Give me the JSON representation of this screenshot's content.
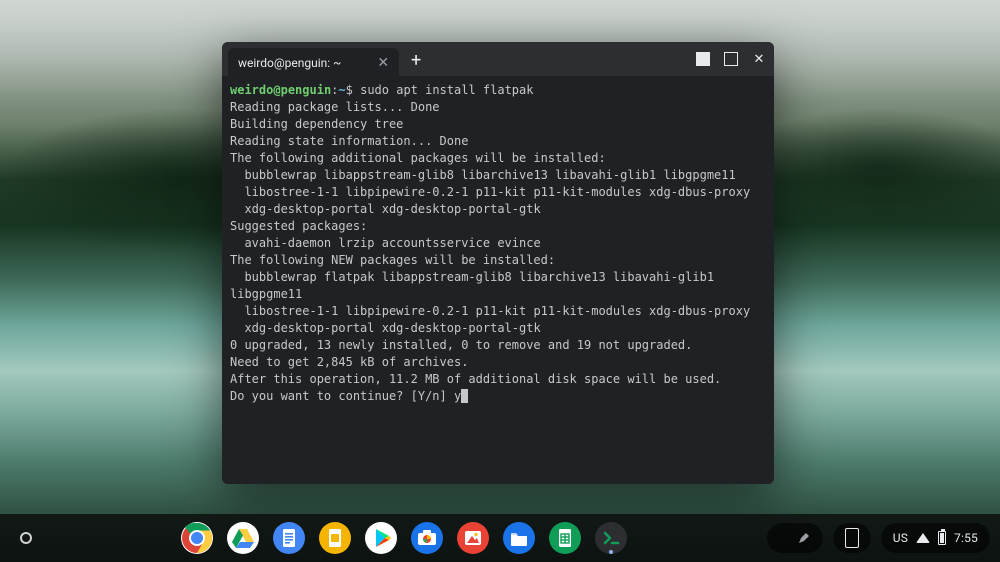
{
  "window": {
    "tab_title": "weirdo@penguin: ~",
    "tab_close": "✕",
    "new_tab": "+",
    "ctrl_close": "✕"
  },
  "prompt": {
    "user": "weirdo",
    "at": "@",
    "host": "penguin",
    "colon": ":",
    "path": "~",
    "dollar": "$ ",
    "command": "sudo apt install flatpak"
  },
  "out": {
    "l01": "Reading package lists... Done",
    "l02": "Building dependency tree",
    "l03": "Reading state information... Done",
    "l04": "The following additional packages will be installed:",
    "l05": "  bubblewrap libappstream-glib8 libarchive13 libavahi-glib1 libgpgme11",
    "l06": "  libostree-1-1 libpipewire-0.2-1 p11-kit p11-kit-modules xdg-dbus-proxy",
    "l07": "  xdg-desktop-portal xdg-desktop-portal-gtk",
    "l08": "Suggested packages:",
    "l09": "  avahi-daemon lrzip accountsservice evince",
    "l10": "The following NEW packages will be installed:",
    "l11": "  bubblewrap flatpak libappstream-glib8 libarchive13 libavahi-glib1 libgpgme11",
    "l12": "  libostree-1-1 libpipewire-0.2-1 p11-kit p11-kit-modules xdg-dbus-proxy",
    "l13": "  xdg-desktop-portal xdg-desktop-portal-gtk",
    "l14": "0 upgraded, 13 newly installed, 0 to remove and 19 not upgraded.",
    "l15": "Need to get 2,845 kB of archives.",
    "l16": "After this operation, 11.2 MB of additional disk space will be used.",
    "l17": "Do you want to continue? [Y/n] y",
    "cursor": " "
  },
  "shelf": {
    "ime": "US",
    "clock": "7:55"
  },
  "icons": {
    "chrome": "chrome-icon",
    "drive": "drive-icon",
    "docs": "docs-icon",
    "slides": "slides-icon",
    "play": "play-icon",
    "camera": "camera-icon",
    "gallery": "gallery-icon",
    "files": "files-icon",
    "sheets": "sheets-icon",
    "terminal": "terminal-icon"
  }
}
